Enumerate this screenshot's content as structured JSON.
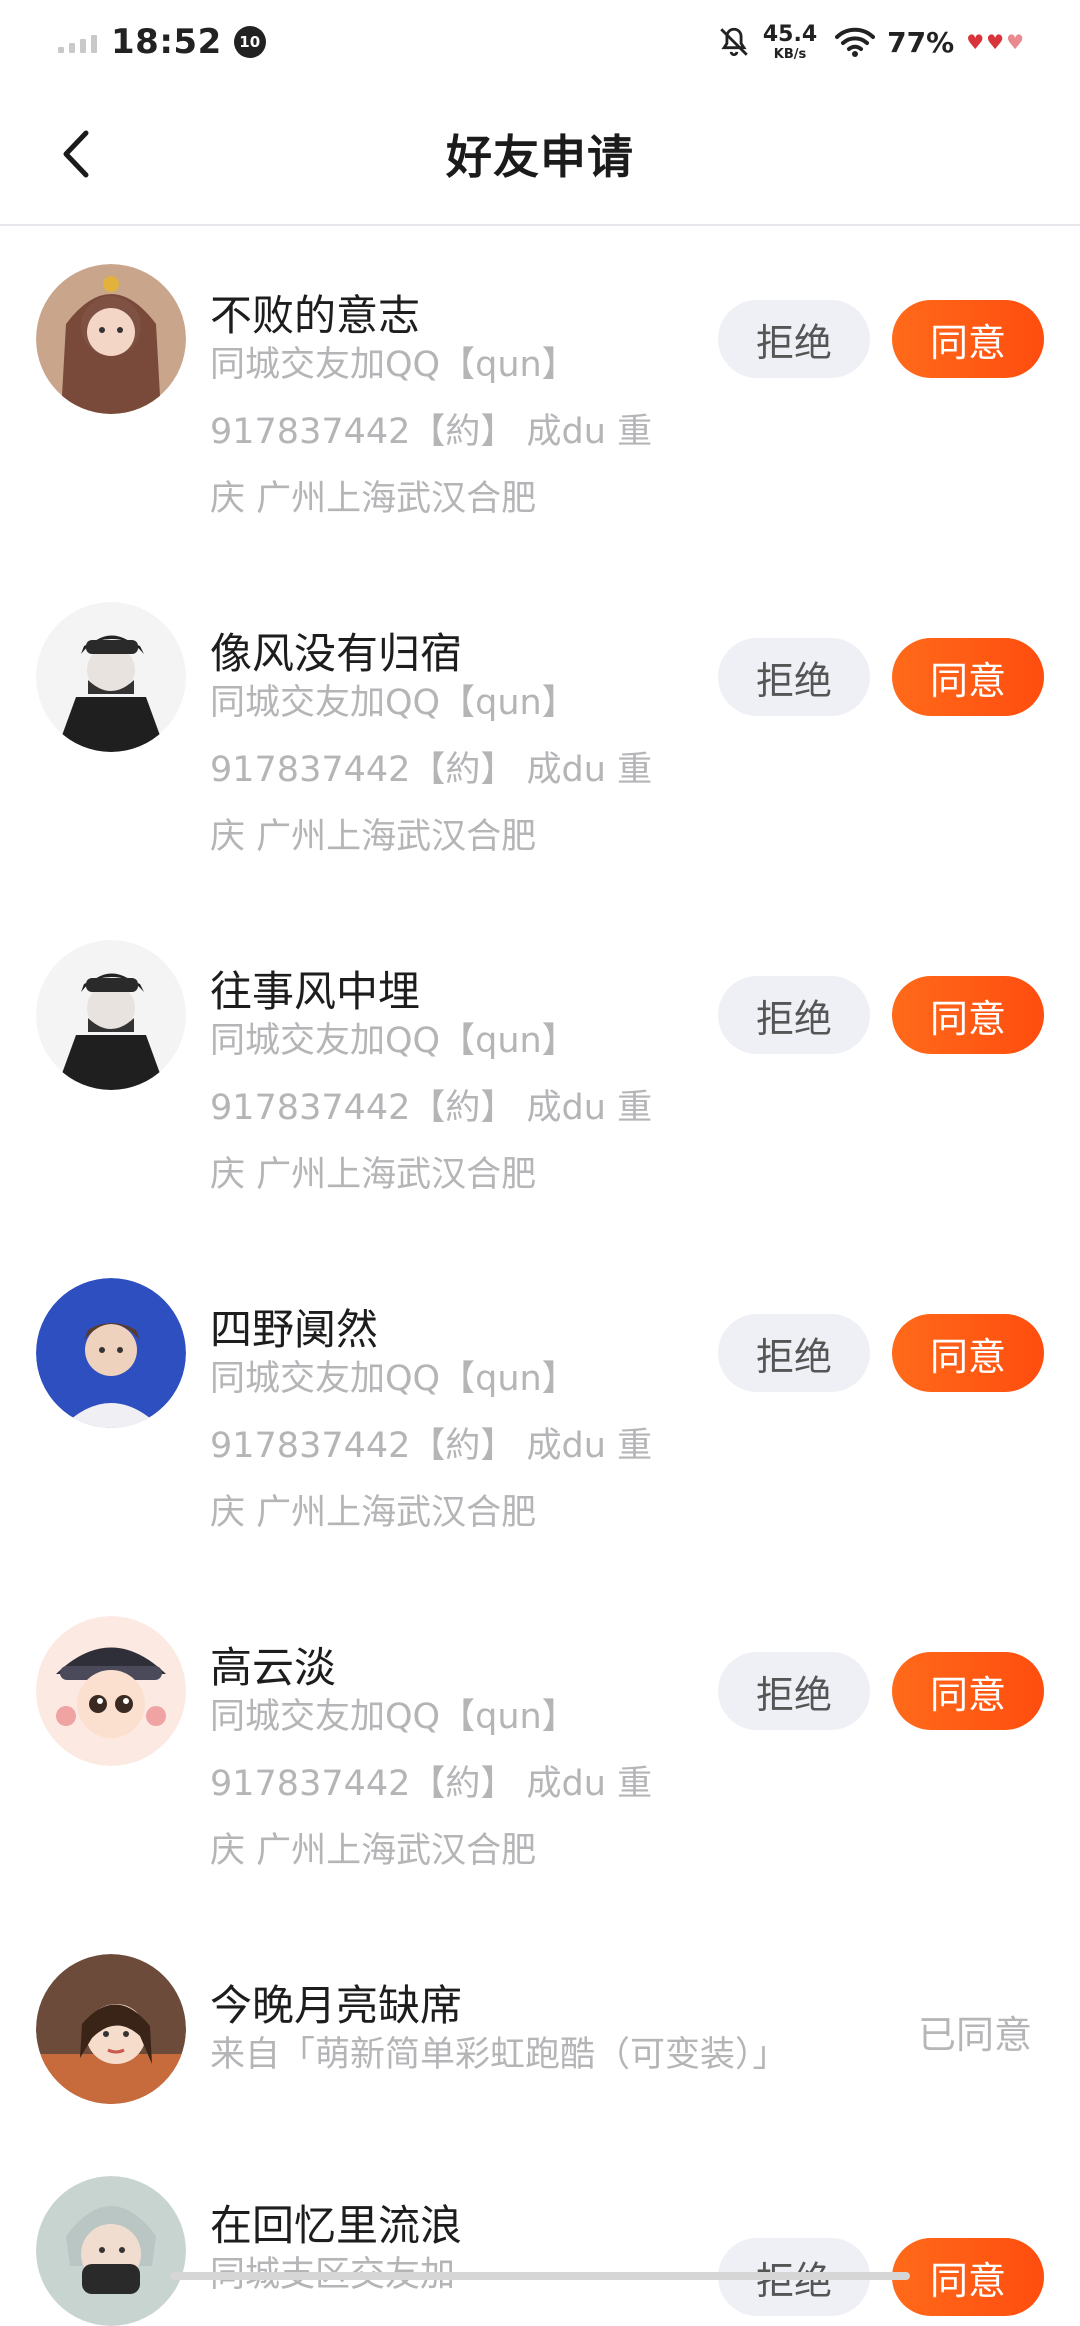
{
  "status_bar": {
    "time": "18:52",
    "notification_count": "10",
    "net_speed_value": "45.4",
    "net_speed_unit": "KB/s",
    "battery": "77%",
    "battery_icon": "hearts-battery-icon"
  },
  "header": {
    "title": "好友申请",
    "back_icon": "chevron-left-icon"
  },
  "buttons": {
    "reject": "拒绝",
    "accept": "同意"
  },
  "requests": [
    {
      "name": "不败的意志",
      "desc_lines": [
        "同城交友加QQ【qun】",
        "917837442【約】 成du 重",
        "庆 广州上海武汉合肥"
      ],
      "status": "pending"
    },
    {
      "name": "像风没有归宿",
      "desc_lines": [
        "同城交友加QQ【qun】",
        "917837442【約】 成du 重",
        "庆 广州上海武汉合肥"
      ],
      "status": "pending"
    },
    {
      "name": "往事风中埋",
      "desc_lines": [
        "同城交友加QQ【qun】",
        "917837442【約】 成du 重",
        "庆 广州上海武汉合肥"
      ],
      "status": "pending"
    },
    {
      "name": "四野阒然",
      "desc_lines": [
        "同城交友加QQ【qun】",
        "917837442【約】 成du 重",
        "庆 广州上海武汉合肥"
      ],
      "status": "pending"
    },
    {
      "name": "高云淡",
      "desc_lines": [
        "同城交友加QQ【qun】",
        "917837442【約】 成du 重",
        "庆 广州上海武汉合肥"
      ],
      "status": "pending"
    },
    {
      "name": "今晚月亮缺席",
      "desc_lines": [
        "来自「萌新简单彩虹跑酷（可变装）」"
      ],
      "status": "accepted",
      "status_label": "已同意"
    },
    {
      "name": "在回忆里流浪",
      "desc_lines": [
        "同城支区交友加"
      ],
      "status": "pending"
    }
  ]
}
